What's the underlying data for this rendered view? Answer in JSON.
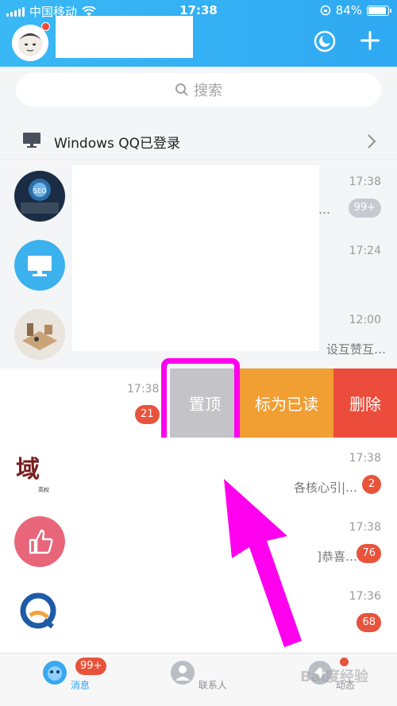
{
  "status_bar": {
    "carrier": "中国移动",
    "time": "17:38",
    "battery_percent": "84%",
    "battery_level": 0.84
  },
  "header": {
    "qzone_icon": "qzone-icon",
    "add_icon": "plus-icon"
  },
  "search": {
    "placeholder": "搜索"
  },
  "login_notice": {
    "label": "Windows QQ已登录"
  },
  "chats": [
    {
      "time": "17:38",
      "preview": "…",
      "badge": "99+",
      "badge_style": "gray"
    },
    {
      "time": "17:24",
      "preview": "",
      "badge": ""
    },
    {
      "time": "12:00",
      "preview": "设互赞互…",
      "badge": ""
    },
    {
      "time": "17:38",
      "preview": "各核心引|…",
      "badge": "2"
    },
    {
      "time": "17:38",
      "preview": "]恭喜…",
      "badge": "76"
    },
    {
      "time": "17:36",
      "preview": "",
      "badge": "68"
    }
  ],
  "swiped_chat": {
    "time": "17:38",
    "badge": "21",
    "actions": {
      "pin": "置顶",
      "mark_read": "标为已读",
      "delete": "删除"
    }
  },
  "brand_avatar_text": "域",
  "brand_avatar_sub": "高权",
  "tabs": [
    {
      "label": "消息",
      "badge": "99+",
      "active": true
    },
    {
      "label": "联系人",
      "active": false
    },
    {
      "label": "动态",
      "active": false
    }
  ],
  "watermark": "Bai度经验",
  "colors": {
    "header_blue": "#39b8f5",
    "highlight": "#ff00ee",
    "pin_gray": "#c4c4c8",
    "mark_read_orange": "#f19e32",
    "delete_red": "#ec4c3b",
    "badge_red": "#e8533c"
  }
}
